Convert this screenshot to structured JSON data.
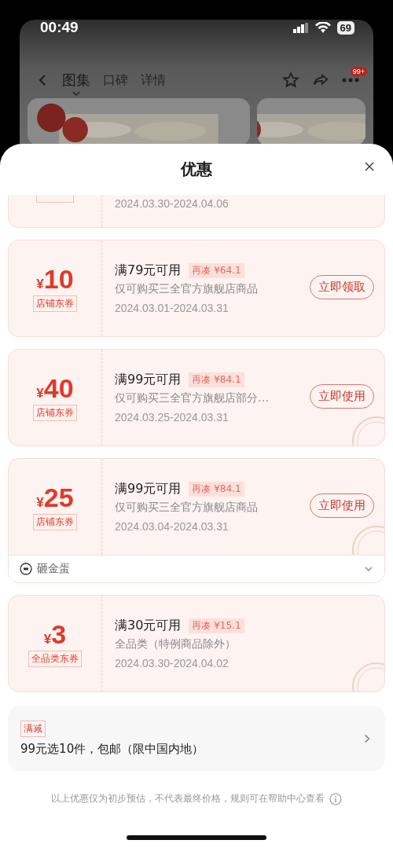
{
  "status_bar": {
    "time": "00:49",
    "battery": "69"
  },
  "nav": {
    "tabs": [
      {
        "label": "图集",
        "selected": true
      },
      {
        "label": "口碑",
        "selected": false
      },
      {
        "label": "详情",
        "selected": false
      }
    ],
    "badge": "99+"
  },
  "sheet": {
    "title": "优惠"
  },
  "partial_coupon": {
    "dates": "2024.03.30-2024.04.06"
  },
  "coupons": [
    {
      "currency": "¥",
      "amount": "10",
      "label": "店铺东券",
      "condition": "满79元可用",
      "topup": "再凑 ¥64.1",
      "scope": "仅可购买三全官方旗舰店商品",
      "dates": "2024.03.01-2024.03.31",
      "action": "立即领取",
      "claimed": false
    },
    {
      "currency": "¥",
      "amount": "40",
      "label": "店铺东券",
      "condition": "满99元可用",
      "topup": "再凑 ¥84.1",
      "scope": "仅可购买三全官方旗舰店部分…",
      "dates": "2024.03.25-2024.03.31",
      "action": "立即使用",
      "claimed": true
    },
    {
      "currency": "¥",
      "amount": "25",
      "label": "店铺东券",
      "condition": "满99元可用",
      "topup": "再凑 ¥84.1",
      "scope": "仅可购买三全官方旗舰店商品",
      "dates": "2024.03.04-2024.03.31",
      "action": "立即使用",
      "claimed": true,
      "footer": "砸金蛋"
    },
    {
      "currency": "¥",
      "amount": "3",
      "label": "全品类东券",
      "condition": "满30元可用",
      "topup": "再凑 ¥15.1",
      "scope": "全品类（特例商品除外）",
      "dates": "2024.03.30-2024.04.02",
      "claimed": true
    }
  ],
  "promo": {
    "tag": "满减",
    "text": "99元选10件，包邮（限中国内地）"
  },
  "note": "以上优惠仅为初步预估，不代表最终价格，规则可在帮助中心查看"
}
